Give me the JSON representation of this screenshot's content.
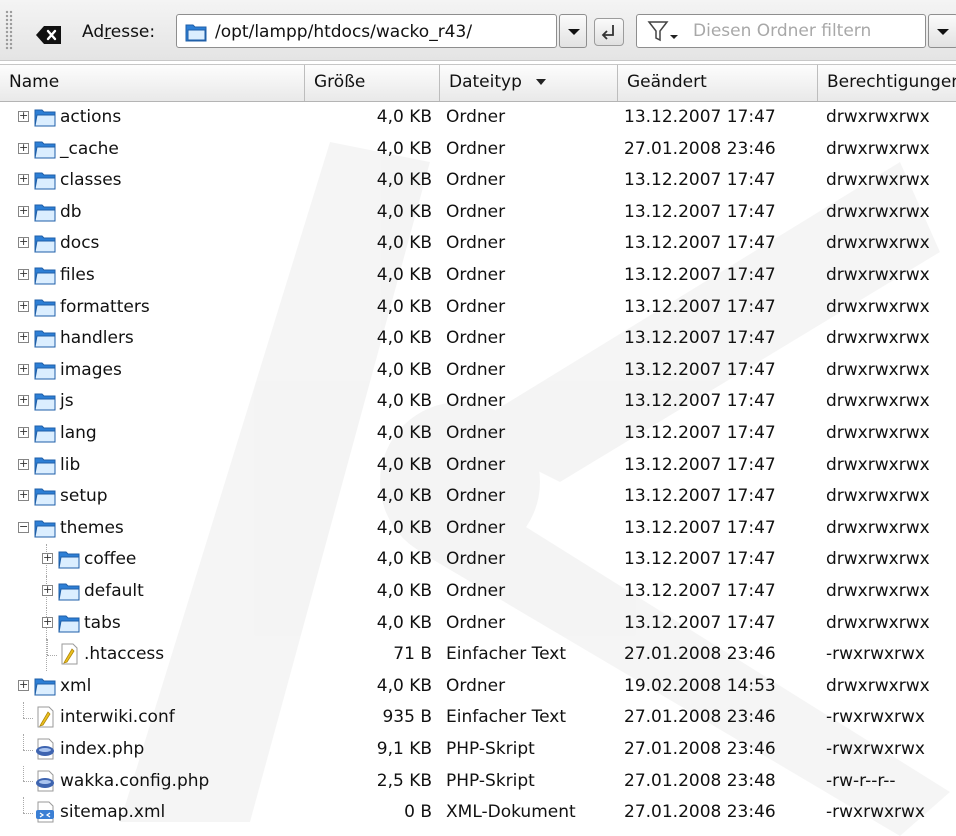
{
  "toolbar": {
    "address_label": "Adresse:",
    "address_value": "/opt/lampp/htdocs/wacko_r43/",
    "filter_placeholder": "Diesen Ordner filtern",
    "icons": {
      "clear": "clear-location-icon",
      "address_folder": "folder-icon",
      "go": "go-return-icon",
      "filter": "funnel-filter-icon"
    }
  },
  "columns": [
    {
      "label": "Name"
    },
    {
      "label": "Größe"
    },
    {
      "label": "Dateityp",
      "sorted": "descending"
    },
    {
      "label": "Geändert"
    },
    {
      "label": "Berechtigungen"
    }
  ],
  "colors": {
    "folder": "#3d8ee0",
    "folder_dark": "#1f5fa8",
    "text_file": "#ecc11f",
    "php": "#3e64b0"
  },
  "rows": [
    {
      "name": "actions",
      "size": "4,0 KB",
      "type": "Ordner",
      "modified": "13.12.2007 17:47",
      "perms": "drwxrwxrwx",
      "icon": "folder-icon",
      "depth": 0,
      "expander": "+"
    },
    {
      "name": "_cache",
      "size": "4,0 KB",
      "type": "Ordner",
      "modified": "27.01.2008 23:46",
      "perms": "drwxrwxrwx",
      "icon": "folder-icon",
      "depth": 0,
      "expander": "+"
    },
    {
      "name": "classes",
      "size": "4,0 KB",
      "type": "Ordner",
      "modified": "13.12.2007 17:47",
      "perms": "drwxrwxrwx",
      "icon": "folder-icon",
      "depth": 0,
      "expander": "+"
    },
    {
      "name": "db",
      "size": "4,0 KB",
      "type": "Ordner",
      "modified": "13.12.2007 17:47",
      "perms": "drwxrwxrwx",
      "icon": "folder-icon",
      "depth": 0,
      "expander": "+"
    },
    {
      "name": "docs",
      "size": "4,0 KB",
      "type": "Ordner",
      "modified": "13.12.2007 17:47",
      "perms": "drwxrwxrwx",
      "icon": "folder-icon",
      "depth": 0,
      "expander": "+"
    },
    {
      "name": "files",
      "size": "4,0 KB",
      "type": "Ordner",
      "modified": "13.12.2007 17:47",
      "perms": "drwxrwxrwx",
      "icon": "folder-icon",
      "depth": 0,
      "expander": "+"
    },
    {
      "name": "formatters",
      "size": "4,0 KB",
      "type": "Ordner",
      "modified": "13.12.2007 17:47",
      "perms": "drwxrwxrwx",
      "icon": "folder-icon",
      "depth": 0,
      "expander": "+"
    },
    {
      "name": "handlers",
      "size": "4,0 KB",
      "type": "Ordner",
      "modified": "13.12.2007 17:47",
      "perms": "drwxrwxrwx",
      "icon": "folder-icon",
      "depth": 0,
      "expander": "+"
    },
    {
      "name": "images",
      "size": "4,0 KB",
      "type": "Ordner",
      "modified": "13.12.2007 17:47",
      "perms": "drwxrwxrwx",
      "icon": "folder-icon",
      "depth": 0,
      "expander": "+"
    },
    {
      "name": "js",
      "size": "4,0 KB",
      "type": "Ordner",
      "modified": "13.12.2007 17:47",
      "perms": "drwxrwxrwx",
      "icon": "folder-icon",
      "depth": 0,
      "expander": "+"
    },
    {
      "name": "lang",
      "size": "4,0 KB",
      "type": "Ordner",
      "modified": "13.12.2007 17:47",
      "perms": "drwxrwxrwx",
      "icon": "folder-icon",
      "depth": 0,
      "expander": "+"
    },
    {
      "name": "lib",
      "size": "4,0 KB",
      "type": "Ordner",
      "modified": "13.12.2007 17:47",
      "perms": "drwxrwxrwx",
      "icon": "folder-icon",
      "depth": 0,
      "expander": "+"
    },
    {
      "name": "setup",
      "size": "4,0 KB",
      "type": "Ordner",
      "modified": "13.12.2007 17:47",
      "perms": "drwxrwxrwx",
      "icon": "folder-icon",
      "depth": 0,
      "expander": "+"
    },
    {
      "name": "themes",
      "size": "4,0 KB",
      "type": "Ordner",
      "modified": "13.12.2007 17:47",
      "perms": "drwxrwxrwx",
      "icon": "folder-icon",
      "depth": 0,
      "expander": "−"
    },
    {
      "name": "coffee",
      "size": "4,0 KB",
      "type": "Ordner",
      "modified": "13.12.2007 17:47",
      "perms": "drwxrwxrwx",
      "icon": "folder-icon",
      "depth": 1,
      "expander": "+"
    },
    {
      "name": "default",
      "size": "4,0 KB",
      "type": "Ordner",
      "modified": "13.12.2007 17:47",
      "perms": "drwxrwxrwx",
      "icon": "folder-icon",
      "depth": 1,
      "expander": "+"
    },
    {
      "name": "tabs",
      "size": "4,0 KB",
      "type": "Ordner",
      "modified": "13.12.2007 17:47",
      "perms": "drwxrwxrwx",
      "icon": "folder-icon",
      "depth": 1,
      "expander": "+"
    },
    {
      "name": ".htaccess",
      "size": "71 B",
      "type": "Einfacher Text",
      "modified": "27.01.2008 23:46",
      "perms": "-rwxrwxrwx",
      "icon": "text-file-icon",
      "depth": 1,
      "expander": ""
    },
    {
      "name": "xml",
      "size": "4,0 KB",
      "type": "Ordner",
      "modified": "19.02.2008 14:53",
      "perms": "drwxrwxrwx",
      "icon": "folder-icon",
      "depth": 0,
      "expander": "+"
    },
    {
      "name": "interwiki.conf",
      "size": "935 B",
      "type": "Einfacher Text",
      "modified": "27.01.2008 23:46",
      "perms": "-rwxrwxrwx",
      "icon": "text-file-icon",
      "depth": 0,
      "expander": ""
    },
    {
      "name": "index.php",
      "size": "9,1 KB",
      "type": "PHP-Skript",
      "modified": "27.01.2008 23:46",
      "perms": "-rwxrwxrwx",
      "icon": "php-script-icon",
      "depth": 0,
      "expander": ""
    },
    {
      "name": "wakka.config.php",
      "size": "2,5 KB",
      "type": "PHP-Skript",
      "modified": "27.01.2008 23:48",
      "perms": "-rw-r--r--",
      "icon": "php-script-icon",
      "depth": 0,
      "expander": ""
    },
    {
      "name": "sitemap.xml",
      "size": "0 B",
      "type": "XML-Dokument",
      "modified": "27.01.2008 23:46",
      "perms": "-rwxrwxrwx",
      "icon": "xml-document-icon",
      "depth": 0,
      "expander": ""
    }
  ]
}
